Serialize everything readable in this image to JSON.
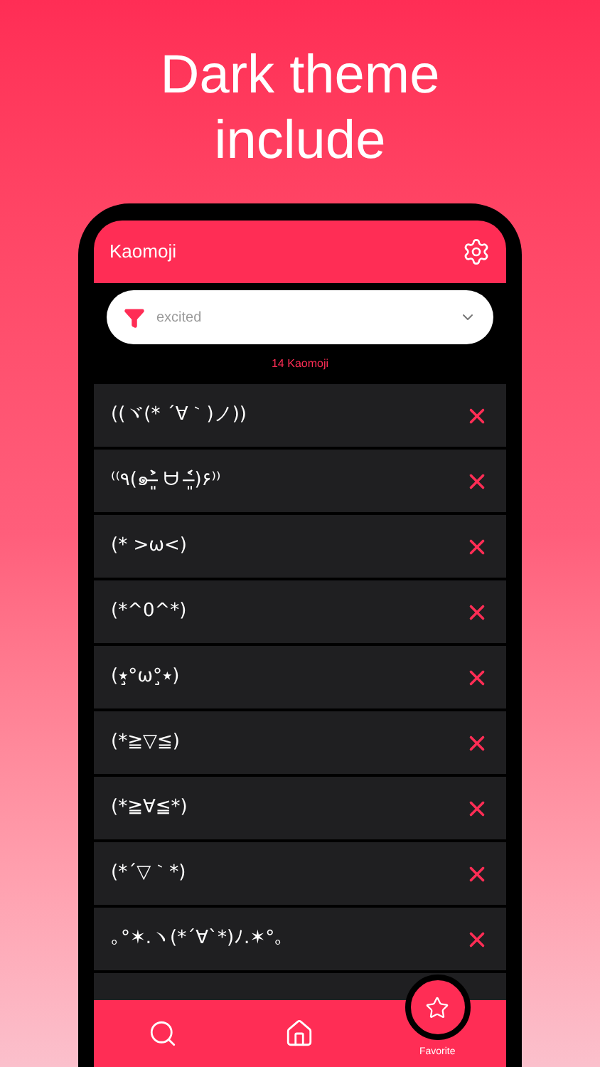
{
  "headline": [
    "Dark theme",
    "include"
  ],
  "app_bar": {
    "title": "Kaomoji"
  },
  "filter": {
    "value": "excited"
  },
  "count": "14 Kaomoji",
  "kaomoji": [
    "((ヾ(* ´∀｀)ノ))",
    "⁽⁽٩(๑˃̶͈̀ ᗨ ˂̶͈́)۶⁾⁾",
    "(* >ω<)",
    "(*^0^*)",
    "(٭°̧̧̧ω°̧̧̧٭)",
    "(*≧▽≦)",
    "(*≧∀≦*)",
    "(*´▽｀*)",
    "｡°✶.ヽ(*´∀`*)ﾉ.✶°｡"
  ],
  "nav": [
    {
      "kind": "search",
      "selected": false
    },
    {
      "kind": "home",
      "selected": false
    },
    {
      "kind": "favorite",
      "label": "Favorite",
      "selected": true
    }
  ]
}
